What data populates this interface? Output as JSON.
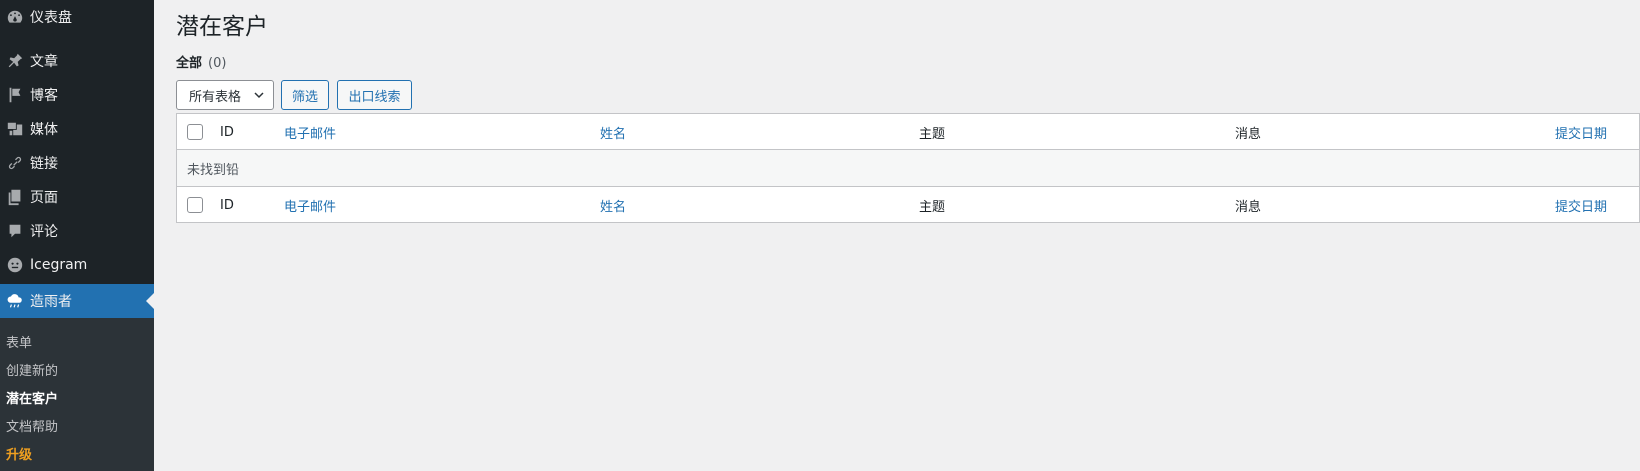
{
  "sidebar": {
    "items": [
      {
        "label": "仪表盘",
        "icon": "dashboard-icon"
      },
      {
        "label": "文章",
        "icon": "pin-icon"
      },
      {
        "label": "博客",
        "icon": "flag-icon"
      },
      {
        "label": "媒体",
        "icon": "media-icon"
      },
      {
        "label": "链接",
        "icon": "link-icon"
      },
      {
        "label": "页面",
        "icon": "page-icon"
      },
      {
        "label": "评论",
        "icon": "comment-icon"
      },
      {
        "label": "Icegram",
        "icon": "icegram-icon"
      },
      {
        "label": "造雨者",
        "icon": "rain-cloud-icon",
        "active": true
      }
    ],
    "submenu": [
      {
        "label": "表单"
      },
      {
        "label": "创建新的"
      },
      {
        "label": "潜在客户",
        "current": true
      },
      {
        "label": "文档帮助"
      },
      {
        "label": "升级",
        "upgrade": true
      }
    ]
  },
  "main": {
    "title": "潜在客户",
    "view_all": "全部",
    "view_all_count": "(0)",
    "filter_select_value": "所有表格",
    "filter_button": "筛选",
    "export_button": "出口线索",
    "table": {
      "columns": [
        "ID",
        "电子邮件",
        "姓名",
        "主题",
        "消息",
        "提交日期"
      ],
      "empty_message": "未找到铅"
    }
  },
  "colors": {
    "sidebar_bg": "#1d2327",
    "submenu_bg": "#2c3338",
    "accent": "#2271b1",
    "upgrade": "#f0a020",
    "page_bg": "#f0f0f1"
  }
}
